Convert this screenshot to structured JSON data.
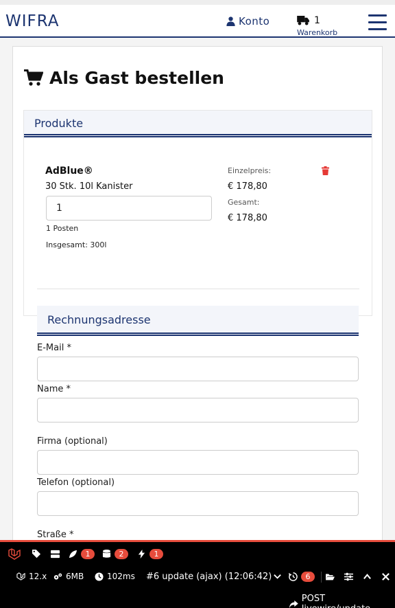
{
  "header": {
    "logo": "WIFRA",
    "account_label": "Konto",
    "cart_count": "1",
    "cart_label": "Warenkorb"
  },
  "page": {
    "title": "Als Gast bestellen"
  },
  "products": {
    "heading": "Produkte",
    "item": {
      "name": "AdBlue®",
      "description": "30 Stk. 10l Kanister",
      "quantity": "1",
      "posten": "1 Posten",
      "total_volume": "Insgesamt: 300l",
      "unit_price_label": "Einzelpreis:",
      "unit_price": "€  178,80",
      "total_label": "Gesamt:",
      "total_price": "€  178,80"
    }
  },
  "billing": {
    "heading": "Rechnungsadresse",
    "fields": {
      "email": "E-Mail *",
      "name": "Name *",
      "company": "Firma (optional)",
      "phone": "Telefon (optional)",
      "street": "Straße *"
    }
  },
  "debugbar": {
    "badges": {
      "views": "1",
      "queries": "2",
      "livewire": "1",
      "history": "6"
    },
    "version": "12.x",
    "memory": "6MB",
    "time": "102ms",
    "request": "#6 update (ajax) (12:06:42)",
    "route": "POST livewire/update"
  },
  "colors": {
    "brand_navy": "#1c3470",
    "danger_red": "#e53935",
    "debug_red": "#e74c3c"
  }
}
